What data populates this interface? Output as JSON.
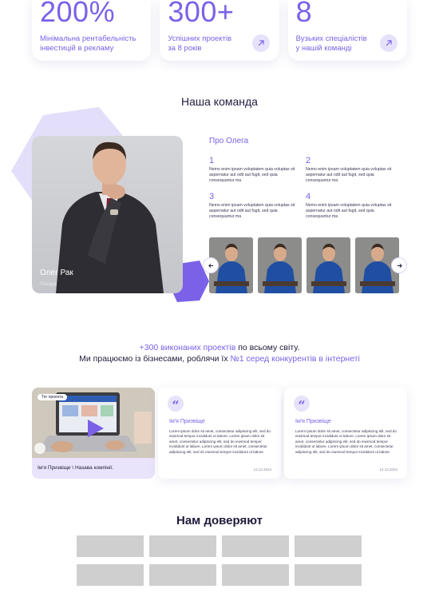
{
  "stats": [
    {
      "number": "200%",
      "text_line1": "Мінімальна рентабельність",
      "text_line2": "інвестицій в рекламу",
      "has_arrow": false
    },
    {
      "number": "300+",
      "text_line1": "Успішних проектів",
      "text_line2": "за 8 років",
      "has_arrow": true
    },
    {
      "number": "8",
      "text_line1": "Вузьких спеціалістів",
      "text_line2": "у нашій команді",
      "has_arrow": true
    }
  ],
  "team": {
    "title": "Наша команда",
    "person_name": "Олег Рак",
    "person_role": "Посада",
    "about_title": "Про Олега",
    "facts": [
      {
        "num": "1",
        "text": "Nemo enim ipsam voluptatem quia voluptas sit aspernatur aut odit aut fugit, sed quia consequuntur ma"
      },
      {
        "num": "2",
        "text": "Nemo enim ipsam voluptatem quia voluptas sit aspernatur aut odit aut fugit, sed quia consequuntur ma"
      },
      {
        "num": "3",
        "text": "Nemo enim ipsam voluptatem quia voluptas sit aspernatur aut odit aut fugit, sed quia consequuntur ma"
      },
      {
        "num": "4",
        "text": "Nemo enim ipsam voluptatem quia voluptas sit aspernatur aut odit aut fugit, sed quia consequuntur ma"
      }
    ]
  },
  "tagline": {
    "accent1": "+300 виконаних проектів",
    "text1": " по всьому світу.",
    "text2": "Ми працюємо із бізнесами, роблячи їх ",
    "accent2": "№1 серед конкурентів в інтернеті"
  },
  "reviews": {
    "video_tag": "Тег проекта",
    "video_caption": "Ім'я Призвіще \\ Назава компінії.",
    "cards": [
      {
        "name": "Ім'я Призвіще",
        "text": "Lorem ipsum dolor sit amet, consectetur adipiscing elit, sed do eiusmod tempor incididunt ut labore. Lorem ipsum dolor sit amet, consectetur adipiscing elit, sed do eiusmod tempor incididunt ut labore. Lorem ipsum dolor sit amet, consectetur adipiscing elit, sed do eiusmod tempor incididunt ut labore",
        "date": "12.12.2024"
      },
      {
        "name": "Ім'я Призвіще",
        "text": "Lorem ipsum dolor sit amet, consectetur adipiscing elit, sed do eiusmod tempor incididunt ut labore. Lorem ipsum dolor sit amet, consectetur adipiscing elit, sed do eiusmod tempor incididunt ut labore. Lorem ipsum dolor sit amet, consectetur adipiscing elit, sed do eiusmod tempor incididunt ut labore",
        "date": "12.12.2024"
      }
    ]
  },
  "trust": {
    "title": "Нам доверяют"
  },
  "colors": {
    "accent": "#7b61e8",
    "accent_light": "#e7e2fb",
    "dark": "#1e1b3a",
    "logo_placeholder": "#cfcfcf"
  }
}
